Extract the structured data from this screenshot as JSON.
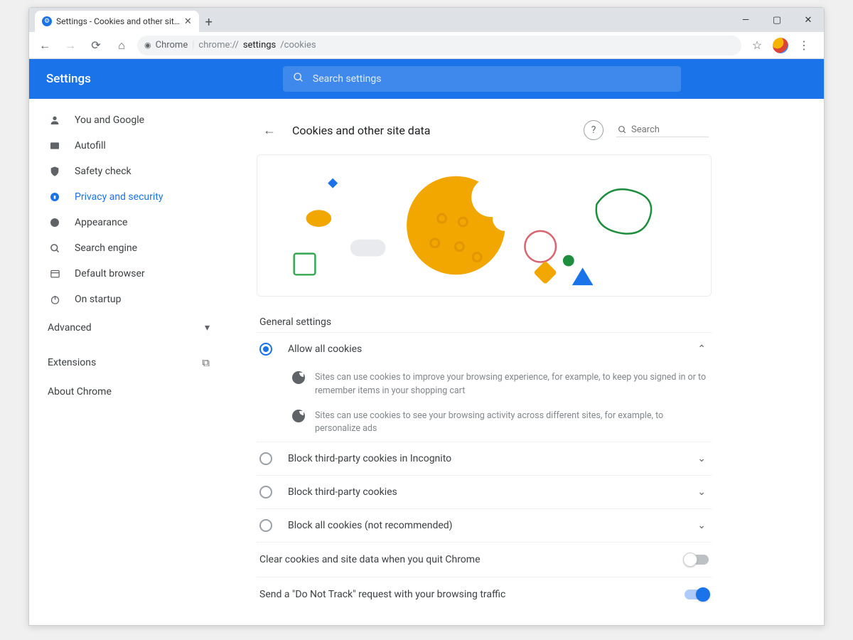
{
  "window": {
    "tab_title": "Settings - Cookies and other sit…",
    "minimize": "—",
    "maximize": "▢",
    "close": "✕",
    "new_tab": "+"
  },
  "omnibox": {
    "security_label": "Chrome",
    "url_dim": "chrome://",
    "url_mid": "settings",
    "url_tail": "/cookies",
    "star": "☆",
    "menu": "⋮"
  },
  "header": {
    "title": "Settings",
    "search_placeholder": "Search settings"
  },
  "sidebar": {
    "items": [
      {
        "icon": "person",
        "label": "You and Google"
      },
      {
        "icon": "autofill",
        "label": "Autofill"
      },
      {
        "icon": "shield",
        "label": "Safety check"
      },
      {
        "icon": "globe",
        "label": "Privacy and security"
      },
      {
        "icon": "paint",
        "label": "Appearance"
      },
      {
        "icon": "search",
        "label": "Search engine"
      },
      {
        "icon": "browser",
        "label": "Default browser"
      },
      {
        "icon": "power",
        "label": "On startup"
      }
    ],
    "advanced": "Advanced",
    "extensions": "Extensions",
    "about": "About Chrome"
  },
  "page": {
    "title": "Cookies and other site data",
    "search_placeholder": "Search"
  },
  "general": {
    "heading": "General settings",
    "options": [
      {
        "label": "Allow all cookies",
        "selected": true,
        "expanded": true
      },
      {
        "label": "Block third-party cookies in Incognito",
        "selected": false,
        "expanded": false
      },
      {
        "label": "Block third-party cookies",
        "selected": false,
        "expanded": false
      },
      {
        "label": "Block all cookies (not recommended)",
        "selected": false,
        "expanded": false
      }
    ],
    "option0_desc": [
      "Sites can use cookies to improve your browsing experience, for example, to keep you signed in or to remember items in your shopping cart",
      "Sites can use cookies to see your browsing activity across different sites, for example, to personalize ads"
    ]
  },
  "toggles": {
    "clear_on_quit": {
      "label": "Clear cookies and site data when you quit Chrome",
      "on": false
    },
    "do_not_track": {
      "label": "Send a \"Do Not Track\" request with your browsing traffic",
      "on": true
    }
  }
}
